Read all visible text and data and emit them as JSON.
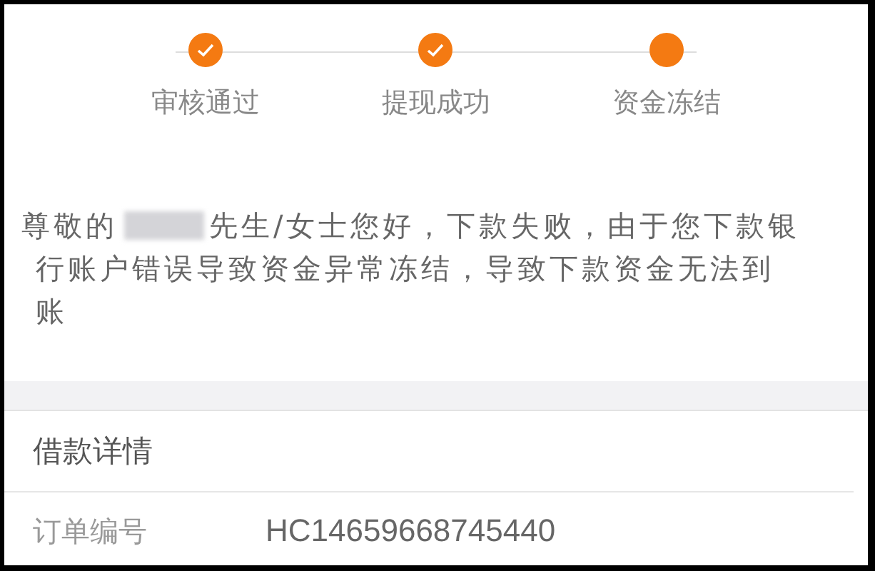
{
  "steps": [
    {
      "label": "审核通过",
      "done": true
    },
    {
      "label": "提现成功",
      "done": true
    },
    {
      "label": "资金冻结",
      "done": false
    }
  ],
  "message": {
    "salutation": "尊敬的",
    "lines": [
      "先生/女士您好，下款失败，由于您下款银",
      "行账户错误导致资金异常冻结，导致下款资金无法到",
      "账"
    ]
  },
  "details": {
    "title": "借款详情",
    "rows": [
      {
        "label": "订单编号",
        "value": "HC14659668745440"
      }
    ]
  }
}
